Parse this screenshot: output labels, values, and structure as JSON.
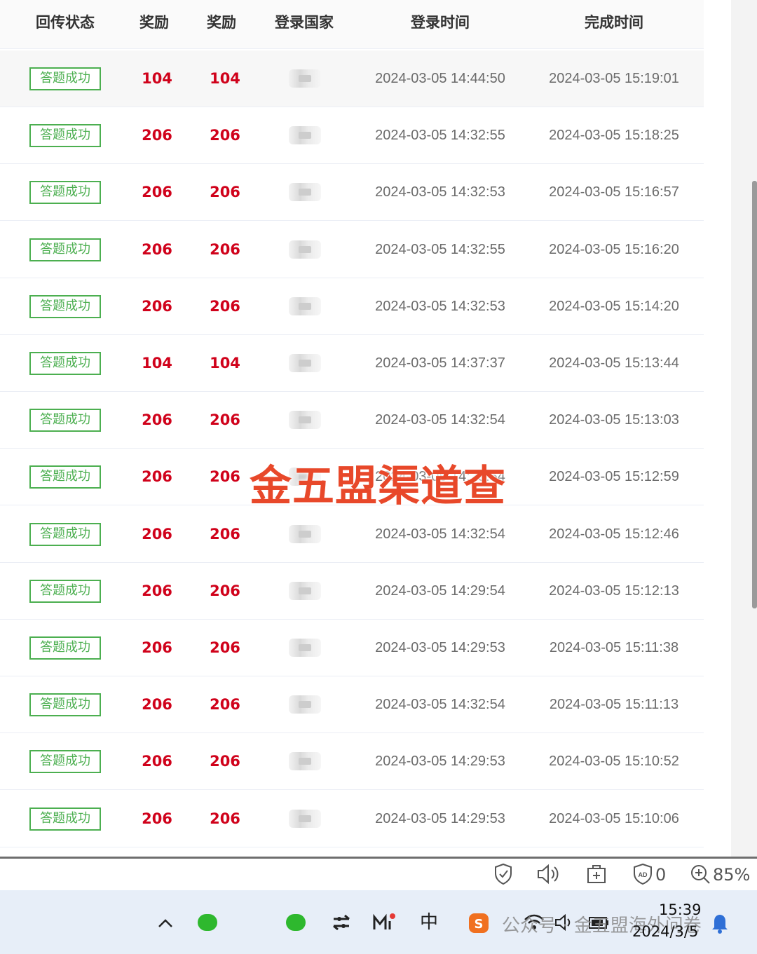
{
  "table": {
    "headers": [
      "回传状态",
      "奖励",
      "奖励",
      "登录国家",
      "登录时间",
      "完成时间"
    ],
    "rows": [
      {
        "status": "答题成功",
        "reward1": "104",
        "reward2": "104",
        "login_time": "2024-03-05 14:44:50",
        "finish_time": "2024-03-05 15:19:01"
      },
      {
        "status": "答题成功",
        "reward1": "206",
        "reward2": "206",
        "login_time": "2024-03-05 14:32:55",
        "finish_time": "2024-03-05 15:18:25"
      },
      {
        "status": "答题成功",
        "reward1": "206",
        "reward2": "206",
        "login_time": "2024-03-05 14:32:53",
        "finish_time": "2024-03-05 15:16:57"
      },
      {
        "status": "答题成功",
        "reward1": "206",
        "reward2": "206",
        "login_time": "2024-03-05 14:32:55",
        "finish_time": "2024-03-05 15:16:20"
      },
      {
        "status": "答题成功",
        "reward1": "206",
        "reward2": "206",
        "login_time": "2024-03-05 14:32:53",
        "finish_time": "2024-03-05 15:14:20"
      },
      {
        "status": "答题成功",
        "reward1": "104",
        "reward2": "104",
        "login_time": "2024-03-05 14:37:37",
        "finish_time": "2024-03-05 15:13:44"
      },
      {
        "status": "答题成功",
        "reward1": "206",
        "reward2": "206",
        "login_time": "2024-03-05 14:32:54",
        "finish_time": "2024-03-05 15:13:03"
      },
      {
        "status": "答题成功",
        "reward1": "206",
        "reward2": "206",
        "login_time": "2024-03-05 14:29:54",
        "finish_time": "2024-03-05 15:12:59"
      },
      {
        "status": "答题成功",
        "reward1": "206",
        "reward2": "206",
        "login_time": "2024-03-05 14:32:54",
        "finish_time": "2024-03-05 15:12:46"
      },
      {
        "status": "答题成功",
        "reward1": "206",
        "reward2": "206",
        "login_time": "2024-03-05 14:29:54",
        "finish_time": "2024-03-05 15:12:13"
      },
      {
        "status": "答题成功",
        "reward1": "206",
        "reward2": "206",
        "login_time": "2024-03-05 14:29:53",
        "finish_time": "2024-03-05 15:11:38"
      },
      {
        "status": "答题成功",
        "reward1": "206",
        "reward2": "206",
        "login_time": "2024-03-05 14:32:54",
        "finish_time": "2024-03-05 15:11:13"
      },
      {
        "status": "答题成功",
        "reward1": "206",
        "reward2": "206",
        "login_time": "2024-03-05 14:29:53",
        "finish_time": "2024-03-05 15:10:52"
      },
      {
        "status": "答题成功",
        "reward1": "206",
        "reward2": "206",
        "login_time": "2024-03-05 14:29:53",
        "finish_time": "2024-03-05 15:10:06"
      }
    ]
  },
  "watermark": "金五盟渠道查",
  "status_bar": {
    "adblock_count": "0",
    "zoom": "85%"
  },
  "taskbar": {
    "ime": "中",
    "public_account_mark": "公众号 · 金五盟海外问卷",
    "time": "15:39",
    "date": "2024/3/5"
  },
  "icons": [
    "shield-check-icon",
    "speaker-icon",
    "add-box-icon",
    "adblock-icon",
    "zoom-in-icon",
    "chevron-up-icon",
    "wechat-icon",
    "switch-icon",
    "ime-icon",
    "sogou-icon",
    "wifi-icon",
    "volume-icon",
    "battery-icon",
    "bell-icon"
  ],
  "colors": {
    "status_green": "#4caf50",
    "reward_red": "#d0021b",
    "watermark_red": "#e8482a",
    "taskbar_bg": "#e7eef8"
  }
}
